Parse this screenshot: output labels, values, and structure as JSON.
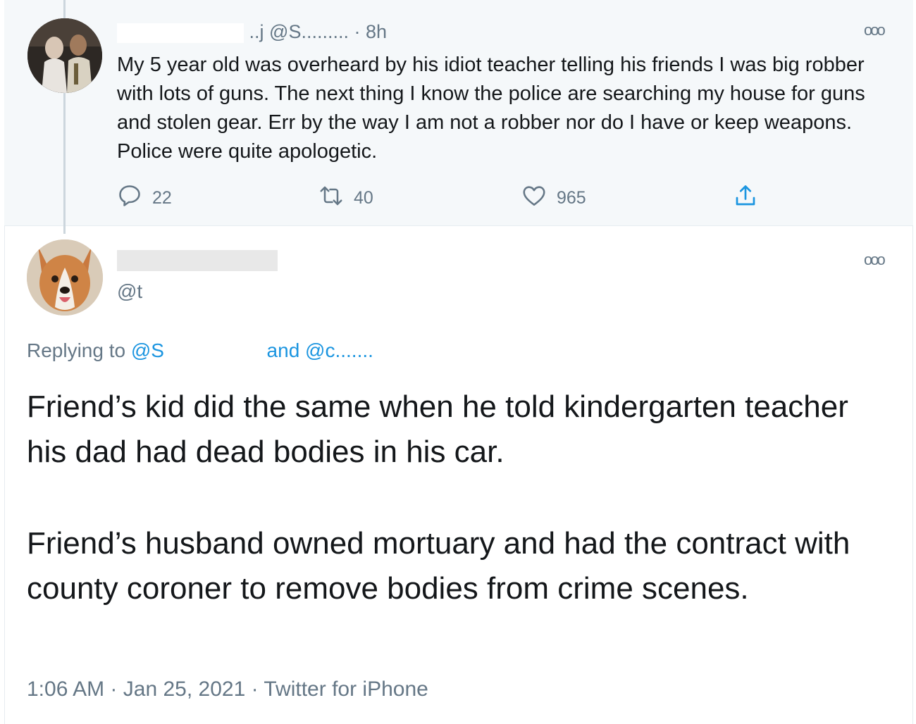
{
  "parent_tweet": {
    "name_fragment": "..j",
    "handle": "@S.........",
    "separator": "·",
    "time": "8h",
    "text": "My 5 year old was overheard by his idiot teacher telling his friends I was big robber with lots of guns. The next thing I know the police are searching my house for guns and stolen gear. Err by the way I am not a robber nor do I have or keep weapons. Police were quite apologetic.",
    "actions": {
      "replies": "22",
      "retweets": "40",
      "likes": "965"
    }
  },
  "reply_tweet": {
    "name": "",
    "handle": "@t",
    "replying_prefix": "Replying to",
    "replying_user1": "@S",
    "replying_and": "and",
    "replying_user2": "@c.......",
    "paragraph1": "Friend’s kid did the same when he told kindergarten teacher his dad had dead bodies in his car.",
    "paragraph2": "Friend’s husband owned mortuary and had the contract with county coroner to remove bodies from crime scenes.",
    "footer": {
      "time": "1:06 AM",
      "date": "Jan 25, 2021",
      "source": "Twitter for iPhone",
      "separator": "·"
    }
  },
  "icons": {
    "more": "more-icon",
    "reply": "reply-icon",
    "retweet": "retweet-icon",
    "like": "heart-icon",
    "share": "share-icon"
  },
  "colors": {
    "link": "#1b95e0",
    "secondary_text": "#657786",
    "parent_background": "#f5f8fa"
  }
}
